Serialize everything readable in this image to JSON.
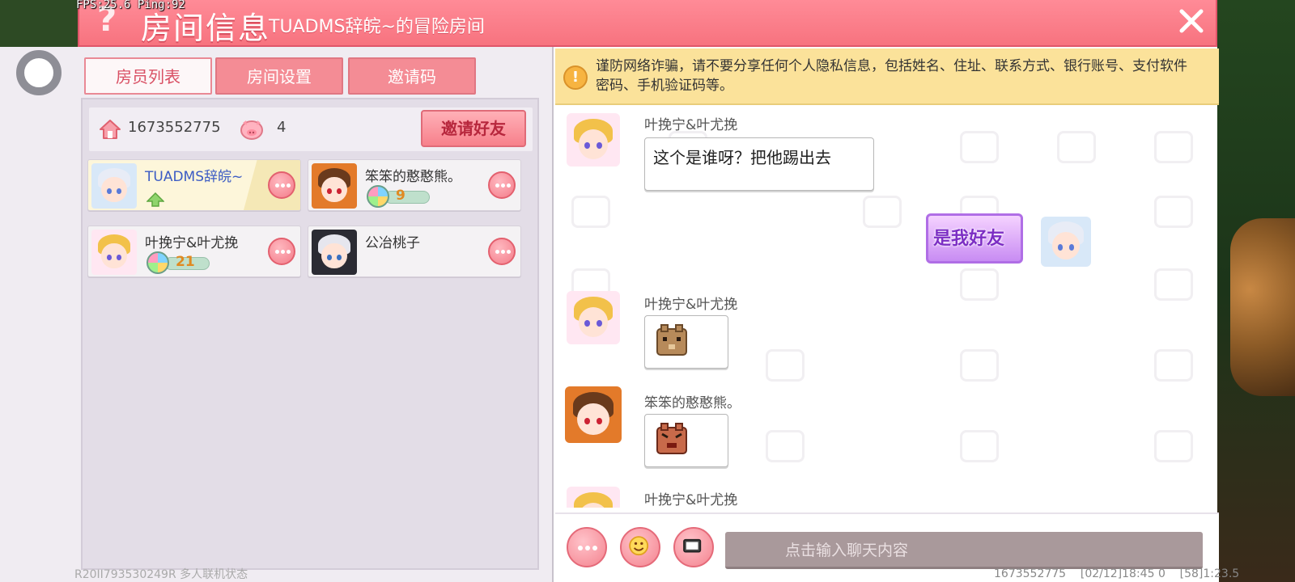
{
  "overlay": {
    "fps_text": "FPS:25.6  Ping:92"
  },
  "header": {
    "help_icon": "?",
    "title": "房间信息",
    "subtitle": "TUADMS辞皖~的冒险房间"
  },
  "tabs": [
    {
      "label": "房员列表",
      "active": true
    },
    {
      "label": "房间设置",
      "active": false
    },
    {
      "label": "邀请码",
      "active": false
    }
  ],
  "room": {
    "id": "1673552775",
    "player_count": "4",
    "invite_button": "邀请好友"
  },
  "members": [
    {
      "name": "TUADMS辞皖~",
      "is_owner": true,
      "level": ""
    },
    {
      "name": "笨笨的憨憨熊。",
      "is_owner": false,
      "level": "9"
    },
    {
      "name": "叶挽宁&叶尤挽",
      "is_owner": false,
      "level": "21"
    },
    {
      "name": "公冶桃子",
      "is_owner": false,
      "level": ""
    }
  ],
  "notice": {
    "icon": "!",
    "text": "谨防网络诈骗，请不要分享任何个人隐私信息，包括姓名、住址、联系方式、银行账号、支付软件密码、手机验证码等。"
  },
  "chat": {
    "messages": [
      {
        "sender": "叶挽宁&叶尤挽",
        "type": "text",
        "text": "这个是谁呀？把他踢出去"
      },
      {
        "sender": "self",
        "type": "sticker",
        "text": "是我好友"
      },
      {
        "sender": "叶挽宁&叶尤挽",
        "type": "emote",
        "text": ""
      },
      {
        "sender": "笨笨的憨憨熊。",
        "type": "emote",
        "text": ""
      },
      {
        "sender": "叶挽宁&叶尤挽",
        "type": "partial",
        "text": ""
      }
    ],
    "input_placeholder": "点击输入聊天内容"
  },
  "footer": {
    "left": "R20II793530249R 多人联机状态",
    "right": "1673552775    [02/12]18:45 0    [58]1:23.5"
  },
  "colors": {
    "header": "#f7737f",
    "tab_active_text": "#d95064",
    "notice_bg": "#fbe29a",
    "accent_pink": "#f4838f"
  }
}
